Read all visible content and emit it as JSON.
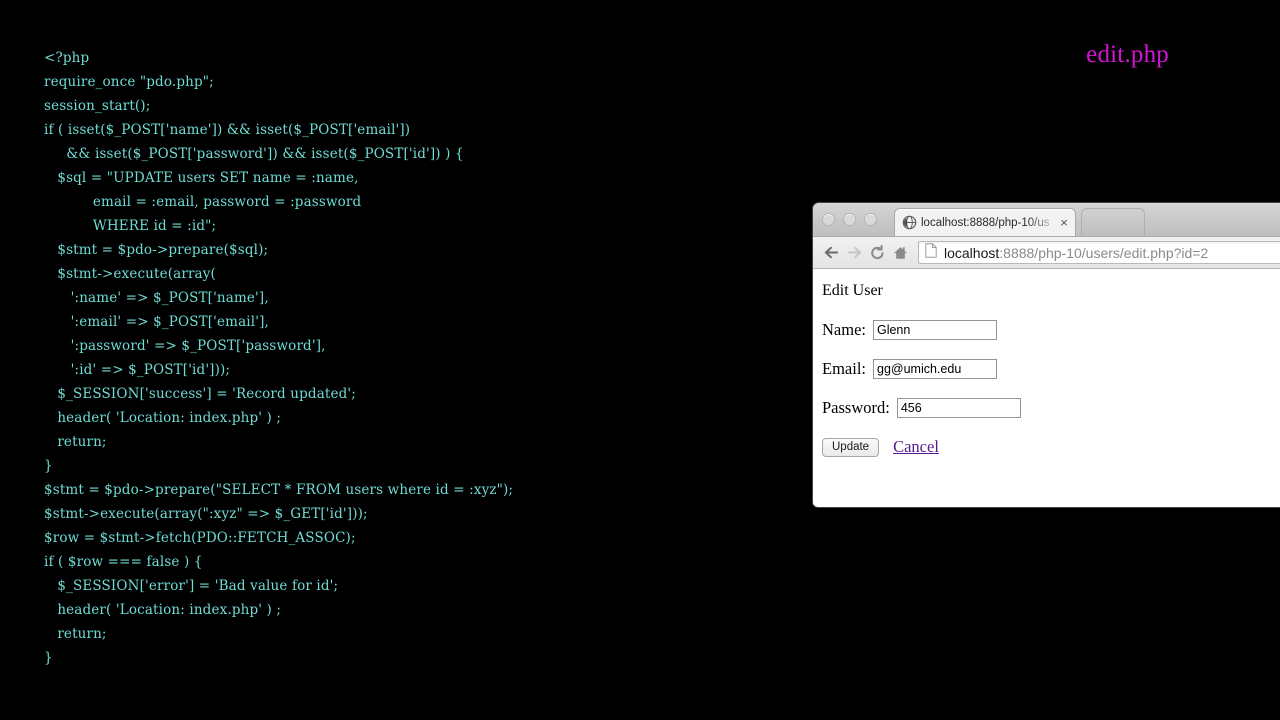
{
  "slide": {
    "title": "edit.php",
    "title_color": "#d414d4",
    "code_color": "#6fdcd4",
    "background_color": "#000000"
  },
  "code": {
    "language": "php",
    "lines": [
      "<?php",
      "require_once \"pdo.php\";",
      "session_start();",
      "if ( isset($_POST['name']) && isset($_POST['email'])",
      "     && isset($_POST['password']) && isset($_POST['id']) ) {",
      "   $sql = \"UPDATE users SET name = :name,",
      "           email = :email, password = :password",
      "           WHERE id = :id\";",
      "   $stmt = $pdo->prepare($sql);",
      "   $stmt->execute(array(",
      "      ':name' => $_POST['name'],",
      "      ':email' => $_POST['email'],",
      "      ':password' => $_POST['password'],",
      "      ':id' => $_POST['id']));",
      "   $_SESSION['success'] = 'Record updated';",
      "   header( 'Location: index.php' ) ;",
      "   return;",
      "}",
      "$stmt = $pdo->prepare(\"SELECT * FROM users where id = :xyz\");",
      "$stmt->execute(array(\":xyz\" => $_GET['id']));",
      "$row = $stmt->fetch(PDO::FETCH_ASSOC);",
      "if ( $row === false ) {",
      "   $_SESSION['error'] = 'Bad value for id';",
      "   header( 'Location: index.php' ) ;",
      "   return;",
      "}"
    ]
  },
  "browser": {
    "tabs": [
      {
        "title": "localhost:8888/php-10/us",
        "favicon": "globe-icon",
        "close_label": "×",
        "active": true
      },
      {
        "title": "",
        "favicon": "",
        "close_label": "",
        "active": false
      }
    ],
    "window_controls": [
      "close",
      "minimize",
      "maximize"
    ],
    "nav": {
      "back_icon": "back-arrow-icon",
      "forward_icon": "forward-arrow-icon",
      "reload_icon": "reload-icon",
      "home_icon": "home-icon"
    },
    "address_bar": {
      "page_icon": "page-document-icon",
      "host": "localhost",
      "path": ":8888/php-10/users/edit.php?id=2",
      "full_url": "localhost:8888/php-10/users/edit.php?id=2"
    },
    "page": {
      "heading": "Edit User",
      "fields": [
        {
          "label": "Name:",
          "value": "Glenn",
          "placeholder": ""
        },
        {
          "label": "Email:",
          "value": "gg@umich.edu",
          "placeholder": ""
        },
        {
          "label": "Password:",
          "value": "456",
          "placeholder": ""
        }
      ],
      "submit_label": "Update",
      "cancel_label": "Cancel",
      "link_color": "#551a8b"
    }
  }
}
